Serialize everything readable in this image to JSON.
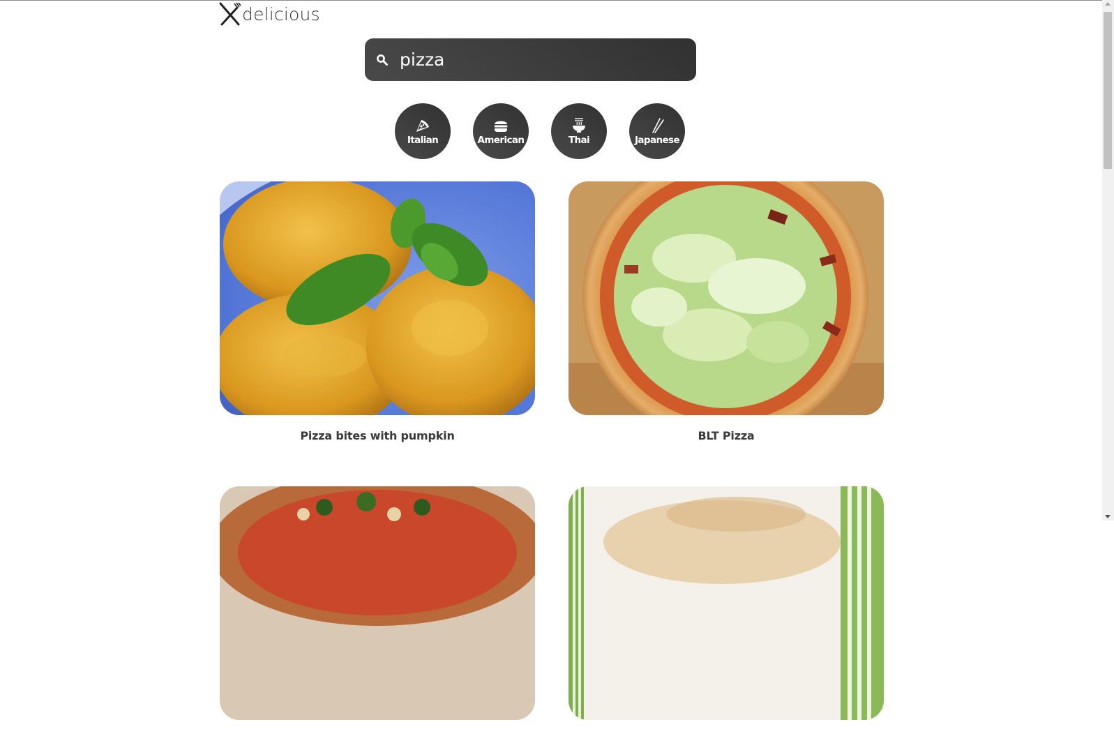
{
  "app": {
    "logo_text": "delicious",
    "logo_icon": "fork-knife-icon"
  },
  "search": {
    "value": "pizza",
    "icon": "search-icon"
  },
  "categories": [
    {
      "label": "Italian",
      "icon": "pizza-icon"
    },
    {
      "label": "American",
      "icon": "burger-icon"
    },
    {
      "label": "Thai",
      "icon": "noodle-bowl-icon"
    },
    {
      "label": "Japanese",
      "icon": "chopsticks-icon"
    }
  ],
  "recipes": [
    {
      "title": "Pizza bites with pumpkin"
    },
    {
      "title": "BLT Pizza"
    },
    {
      "title": ""
    },
    {
      "title": ""
    }
  ],
  "colors": {
    "button_dark": "#3b3b3b",
    "text": "#333333",
    "background": "#ffffff"
  }
}
